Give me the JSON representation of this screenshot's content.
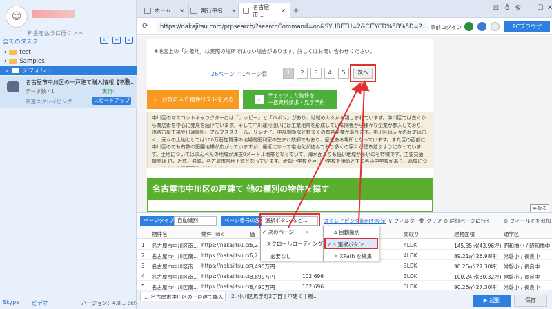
{
  "left": {
    "upgrade": "料金を払うに行く >>",
    "all_tasks": "全てのタスク",
    "folders": [
      "test",
      "Samples"
    ],
    "default_folder": "デフォルト",
    "task": {
      "name": "名古屋市中川区の一戸建て購入情報【不動...",
      "data_count": "データ数  41",
      "status": "実行中",
      "fast_scrape": "高速スクレイピング",
      "speedup": "スピードアップ"
    },
    "skype": "Skype",
    "video": "ビデオ",
    "version": "バージョン：4.0.1-beta.6"
  },
  "browser": {
    "tabs": [
      "ホーム...",
      "実行中名...",
      "名古屋市..."
    ],
    "url": "https://nakajitsu.com/prpsearch/?searchCommand=on&SYUBETU=2&CITYCD%5B%5D=2...",
    "prev_login": "事前ログイン",
    "pc_browser": "PCブラウザ"
  },
  "web": {
    "notice": "※地図上の「対象地」は実際の場所ではない場合があります。詳しくはお問い合わせください。",
    "page_info_link": "26ページ",
    "page_info_rest": " 中1ページ目",
    "pages": [
      "1",
      "2",
      "3",
      "4",
      "5"
    ],
    "next": "次へ",
    "fav_button": "お気に入り物件リストを見る",
    "check_button_l1": "チェックした物件を",
    "check_button_l2": "一括資料請求・見学予約",
    "info_text": "中川区のマスコットキャラクターには「ナッピー」と「ハボン」があり、地域の人々から親しまれています。中川区では古くから商店街を中心に発展を続けています。そして中川運河沿いには工業地帯を形成している関係から様々な企業が参入しており、JR名古屋工場や日通製粉、アルプススチール、リンナイ、中部鋼鈑など数多くの有名企業があります。中川区は元々の歴史は古く、元々の土地としては100万石加賀藩の地場前田利家の生まれ故郷でもあり、歴史ある場所となっています。また区の西部に中川区のでも有数の田園地帯が広がっていますが、最近になって宅地化が進んでおり多くの家々が建ち並ぶようになっています。土地についてはまんべんの地域が海抜0メートル地帯となっていて、海水面よりも低い地域が多いのも特徴です。主要交通機関は JR、近鉄、名鉄、名古屋市営地下鉄となっています。愛知小学校や戸田小学校を始めとする各小中学校があり、高校については中川商業高等学校があります。",
    "green_title": "名古屋市中川区の戸建て  他の種別の物件を探す",
    "collapse": "≫折る"
  },
  "toolbar": {
    "page_type_label": "ページタイプ",
    "page_type_value": "自動識別",
    "page_num_label": "ページ番号の設定",
    "page_num_value": "選択ボタン など...",
    "scrape_range": "スクレイピング範囲を設定",
    "filter": "フィルター",
    "clear": "クリア",
    "detail": "詳細ページに行く",
    "add_field": "フィールドを追加"
  },
  "menu1": [
    "次のページ",
    "スクロールローディング",
    "必要なし"
  ],
  "menu2": [
    "自動識別",
    "選択ボタン",
    "XPath を編集"
  ],
  "table": {
    "headers": [
      "物件名",
      "物件_link",
      "価",
      "",
      "間取り",
      "建物面積",
      "通学区"
    ],
    "rows": [
      [
        "1",
        "名古屋市中川区南...",
        "https://nakajitsu.co...",
        "5,2...",
        "",
        "4LDK",
        "145.35㎡(43.96坪)",
        "昭和橋小 / 昭和橋中"
      ],
      [
        "2",
        "名古屋市中川区南...",
        "https://nakajitsu.co...",
        "5,2...",
        "",
        "4LDK",
        "89.21㎡(26.98坪)",
        "常磐小 / 長良中"
      ],
      [
        "3",
        "名古屋市中川区南...",
        "https://nakajitsu.co...",
        "3,490万円",
        "",
        "3LDK",
        "90.25㎡(27.30坪)",
        "常磐小 / 長良中"
      ],
      [
        "4",
        "名古屋市中川区南...",
        "https://nakajitsu.co...",
        "3,890万円",
        "102,696",
        "3LDK",
        "100.24㎡(30.32坪)",
        "常磐小 / 長良中"
      ],
      [
        "5",
        "名古屋市中川区南...",
        "https://nakajitsu.co...",
        "3,490万円",
        "102,696",
        "3LDK",
        "90.25㎡(27.30坪)",
        "常磐小 / 長良中"
      ]
    ]
  },
  "bottom_tabs": [
    "1. 名古屋市中川区の一戸建て購入...",
    "2. 中川区馬手町2丁目 | 戸建て | 販..."
  ],
  "start": "起動",
  "save": "保存"
}
